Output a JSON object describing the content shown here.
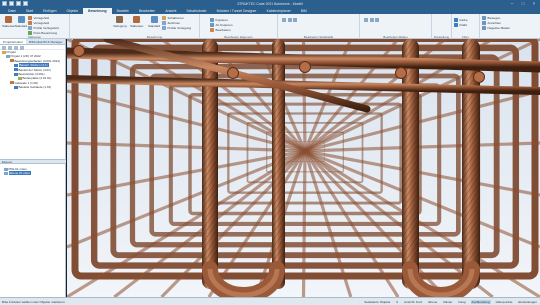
{
  "window": {
    "title": "STRUKTEC Crate 2021 Bohrkerne - Modell",
    "controls": [
      "–",
      "□",
      "×"
    ]
  },
  "ribbon_tabs": [
    "Datei",
    "Start",
    "Einfügen",
    "Objekte",
    "Bewehrung",
    "Bauteile",
    "Bearbeiten",
    "Ansicht",
    "Schaltroboter",
    "Brücken / Tunnel Designer",
    "Kabelrohrplaner",
    "BIM"
  ],
  "active_tab_index": 4,
  "ribbon": {
    "groups": [
      {
        "title": "Stabeisen",
        "big": [
          "Stabeisen",
          "Standard",
          "Preis Bewehrung"
        ],
        "small": [
          "Verlegefeld",
          "Verlegefeld",
          "Profile Verlegefeld"
        ]
      },
      {
        "title": "Bewehrung",
        "big": [
          "Verlegung",
          "Stabeisen",
          "Standard"
        ],
        "small": [
          "Schablonen",
          "Zeichnen",
          "Profile Verlegung"
        ]
      },
      {
        "title": "Bearbeiten allgemein",
        "big": [],
        "small": [
          "Kopieren",
          "Ab Kopieren",
          "Bearbeiten"
        ]
      },
      {
        "title": "Bearbeiten Stahlstatik",
        "big": [],
        "small": []
      },
      {
        "title": "Bearbeiten Matten",
        "big": [],
        "small": []
      },
      {
        "title": "Darstellung",
        "big": [],
        "small": []
      },
      {
        "title": "Filter",
        "big": [],
        "small": [
          "Farbe",
          "Draht"
        ]
      },
      {
        "title": "",
        "big": [],
        "small": [
          "Bewegen",
          "Ansichten",
          "Negative Matten"
        ]
      }
    ]
  },
  "left_panel": {
    "tabs": [
      "Projektstruktur",
      "BIMcollab BCF Manager"
    ],
    "tree": [
      {
        "label": "Projekt",
        "level": 0
      },
      {
        "label": "Projekt 1 (2D) 47 2022",
        "level": 1
      },
      {
        "label": "Bewehrungsarbeiten (4-001 2021)",
        "level": 2
      },
      {
        "label": "Bauteil: Stützen (4-1)",
        "level": 3,
        "selected": true
      },
      {
        "label": "Bauteil der Stütze (4.01)",
        "level": 3
      },
      {
        "label": "Bewehrplan (4.001)",
        "level": 3
      },
      {
        "label": "Bodenplatte (4.01.01)",
        "level": 4
      },
      {
        "label": "Gebäude 1 (1.00)",
        "level": 2
      },
      {
        "label": "Bauteile Gebäude (1.01)",
        "level": 3
      }
    ],
    "lower_title": "Ebenen",
    "lower_list": [
      "PFE 01 unten",
      "Ebene 01 oben"
    ],
    "lower_selected": 1
  },
  "statusbar": {
    "message": "Bitte Funktion wählen oder Objekte markieren",
    "items": [
      "Selektierte Objekte",
      "0",
      "Ansicht: Kurz",
      "Ebene",
      "Raster",
      "Fang",
      "Ausblendung",
      "Gitterpunkte",
      "Einstellungen"
    ],
    "active_index": 6
  },
  "colors": {
    "title_bar": "#2b5f8e",
    "ribbon_bg": "#eef3f8",
    "rebar": "#9a5a3a",
    "rebar_highlight": "#c98a63",
    "rebar_shadow": "#4e2a18",
    "sky": "#eaf0f6"
  }
}
